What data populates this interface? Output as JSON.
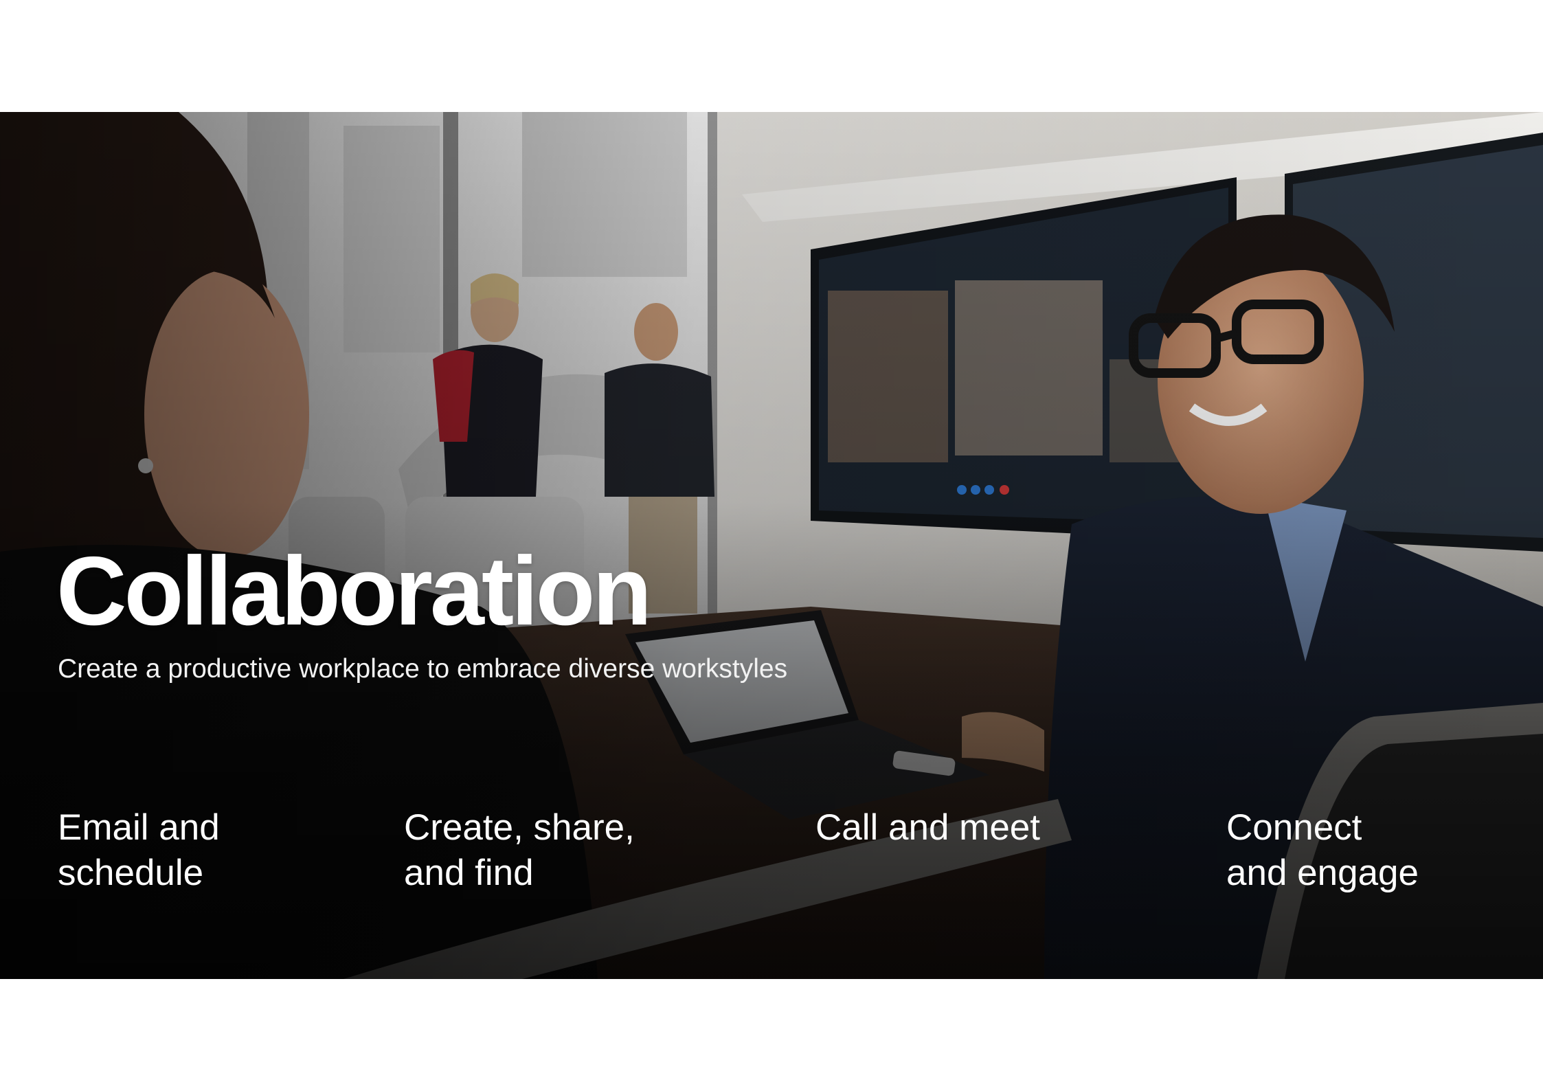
{
  "slide": {
    "title": "Collaboration",
    "subtitle": "Create a productive workplace to embrace diverse workstyles",
    "features": [
      {
        "line1": "Email and",
        "line2": "schedule"
      },
      {
        "line1": "Create, share,",
        "line2": "and find"
      },
      {
        "line1": "Call and meet",
        "line2": ""
      },
      {
        "line1": "Connect",
        "line2": "and engage"
      }
    ]
  },
  "hero_image": {
    "scene": "meeting-room-photo",
    "colors": {
      "window_light": "#e9e9e9",
      "wall": "#d8d6d2",
      "screen": "#1c2530",
      "table": "#3b2a22",
      "suit": "#1b2333",
      "shade": "#0d0d0d"
    }
  }
}
